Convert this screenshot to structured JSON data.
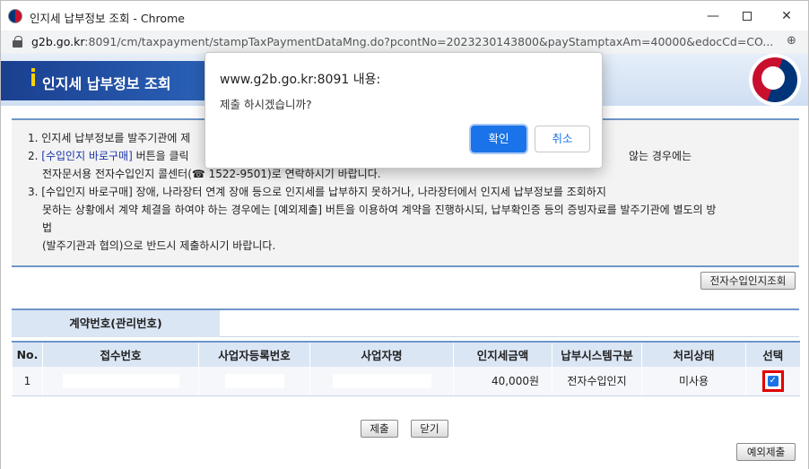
{
  "window": {
    "title": "인지세 납부정보 조회 - Chrome",
    "min_label": "—",
    "close_label": "✕"
  },
  "address": {
    "host": "g2b.go.kr",
    "rest": ":8091/cm/taxpayment/stampTaxPaymentDataMng.do?pcontNo=2023230143800&payStamptaxAm=40000&edocCd=CO...",
    "zoom_icon": "⊕"
  },
  "header": {
    "title": "인지세 납부정보 조회"
  },
  "notice": {
    "line1": "1. 인지세 납부정보를 발주기관에 제",
    "line2_blue": "[수입인지 바로구매]",
    "line2_prefix": "2. ",
    "line2_rest": " 버튼을 클릭",
    "line2_tail": "않는 경우에는",
    "line3": "전자문서용 전자수입인지 콜센터(☎ 1522-9501)로 연락하시기 바랍니다.",
    "line4": "3. [수입인지 바로구매] 장애, 나라장터 연계 장애 등으로 인지세를 납부하지 못하거나, 나라장터에서 인지세 납부정보를 조회하지",
    "line5": "못하는 상황에서 계약 체결을 하여야 하는 경우에는 [예외제출] 버튼을 이용하여 계약을 진행하시되, 납부확인증 등의 증빙자료를 발주기관에 별도의 방",
    "line6": "법",
    "line7": "(발주기관과 협의)으로 반드시 제출하시기 바랍니다."
  },
  "buttons": {
    "lookup": "전자수입인지조회",
    "submit": "제출",
    "close": "닫기",
    "except": "예외제출"
  },
  "contract": {
    "label": "계약번호(관리번호)"
  },
  "table": {
    "headers": [
      "No.",
      "접수번호",
      "사업자등록번호",
      "사업자명",
      "인지세금액",
      "납부시스템구분",
      "처리상태",
      "선택"
    ],
    "rows": [
      {
        "no": "1",
        "amount": "40,000원",
        "system": "전자수입인지",
        "status": "미사용",
        "checked": "✓"
      }
    ]
  },
  "dialog": {
    "title": "www.g2b.go.kr:8091 내용:",
    "message": "제출 하시겠습니까?",
    "ok": "확인",
    "cancel": "취소"
  }
}
